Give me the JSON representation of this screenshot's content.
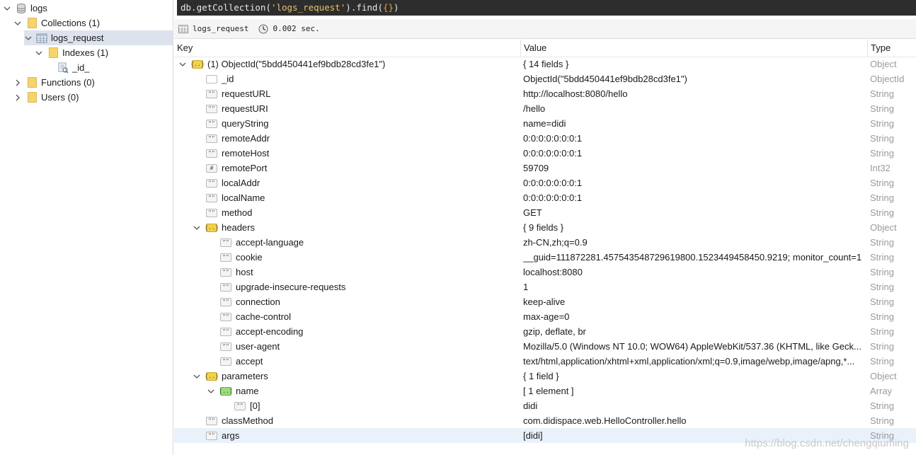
{
  "tree": {
    "db": {
      "label": "logs"
    },
    "collections": {
      "label": "Collections (1)"
    },
    "collection": {
      "label": "logs_request"
    },
    "indexes": {
      "label": "Indexes (1)"
    },
    "index": {
      "label": "_id_"
    },
    "functions": {
      "label": "Functions (0)"
    },
    "users": {
      "label": "Users (0)"
    }
  },
  "query": {
    "prefix": "db.getCollection(",
    "name": "'logs_request'",
    "mid": ").find(",
    "args": "{}",
    "end": ")"
  },
  "result_info": {
    "collection": "logs_request",
    "time": "0.002 sec."
  },
  "columns": {
    "key": "Key",
    "value": "Value",
    "type": "Type"
  },
  "rows": [
    {
      "key": "(1) ObjectId(\"5bdd450441ef9bdb28cd3fe1\")",
      "value": "{ 14 fields }",
      "type": "Object",
      "icon": "object-icon",
      "iconText": "{..}"
    },
    {
      "key": "_id",
      "value": "ObjectId(\"5bdd450441ef9bdb28cd3fe1\")",
      "type": "ObjectId",
      "icon": "objectid-icon",
      "iconText": ""
    },
    {
      "key": "requestURL",
      "value": "http://localhost:8080/hello",
      "type": "String",
      "icon": "string-icon",
      "iconText": "\"\""
    },
    {
      "key": "requestURI",
      "value": "/hello",
      "type": "String",
      "icon": "string-icon",
      "iconText": "\"\""
    },
    {
      "key": "queryString",
      "value": "name=didi",
      "type": "String",
      "icon": "string-icon",
      "iconText": "\"\""
    },
    {
      "key": "remoteAddr",
      "value": "0:0:0:0:0:0:0:1",
      "type": "String",
      "icon": "string-icon",
      "iconText": "\"\""
    },
    {
      "key": "remoteHost",
      "value": "0:0:0:0:0:0:0:1",
      "type": "String",
      "icon": "string-icon",
      "iconText": "\"\""
    },
    {
      "key": "remotePort",
      "value": "59709",
      "type": "Int32",
      "icon": "int-icon",
      "iconText": "#"
    },
    {
      "key": "localAddr",
      "value": "0:0:0:0:0:0:0:1",
      "type": "String",
      "icon": "string-icon",
      "iconText": "\"\""
    },
    {
      "key": "localName",
      "value": "0:0:0:0:0:0:0:1",
      "type": "String",
      "icon": "string-icon",
      "iconText": "\"\""
    },
    {
      "key": "method",
      "value": "GET",
      "type": "String",
      "icon": "string-icon",
      "iconText": "\"\""
    },
    {
      "key": "headers",
      "value": "{ 9 fields }",
      "type": "Object",
      "icon": "object-icon",
      "iconText": "{..}"
    },
    {
      "key": "accept-language",
      "value": "zh-CN,zh;q=0.9",
      "type": "String",
      "icon": "string-icon",
      "iconText": "\"\""
    },
    {
      "key": "cookie",
      "value": "__guid=111872281.457543548729619800.1523449458450.9219; monitor_count=1",
      "type": "String",
      "icon": "string-icon",
      "iconText": "\"\""
    },
    {
      "key": "host",
      "value": "localhost:8080",
      "type": "String",
      "icon": "string-icon",
      "iconText": "\"\""
    },
    {
      "key": "upgrade-insecure-requests",
      "value": "1",
      "type": "String",
      "icon": "string-icon",
      "iconText": "\"\""
    },
    {
      "key": "connection",
      "value": "keep-alive",
      "type": "String",
      "icon": "string-icon",
      "iconText": "\"\""
    },
    {
      "key": "cache-control",
      "value": "max-age=0",
      "type": "String",
      "icon": "string-icon",
      "iconText": "\"\""
    },
    {
      "key": "accept-encoding",
      "value": "gzip, deflate, br",
      "type": "String",
      "icon": "string-icon",
      "iconText": "\"\""
    },
    {
      "key": "user-agent",
      "value": "Mozilla/5.0 (Windows NT 10.0; WOW64) AppleWebKit/537.36 (KHTML, like Geck...",
      "type": "String",
      "icon": "string-icon",
      "iconText": "\"\""
    },
    {
      "key": "accept",
      "value": "text/html,application/xhtml+xml,application/xml;q=0.9,image/webp,image/apng,*...",
      "type": "String",
      "icon": "string-icon",
      "iconText": "\"\""
    },
    {
      "key": "parameters",
      "value": "{ 1 field }",
      "type": "Object",
      "icon": "object-icon",
      "iconText": "{..}"
    },
    {
      "key": "name",
      "value": "[ 1 element ]",
      "type": "Array",
      "icon": "array-icon",
      "iconText": "[..]"
    },
    {
      "key": "[0]",
      "value": "didi",
      "type": "String",
      "icon": "string-icon",
      "iconText": "\"\""
    },
    {
      "key": "classMethod",
      "value": "com.didispace.web.HelloController.hello",
      "type": "String",
      "icon": "string-icon",
      "iconText": "\"\""
    },
    {
      "key": "args",
      "value": "[didi]",
      "type": "String",
      "icon": "string-icon",
      "iconText": "\"\""
    }
  ],
  "watermark": "https://blog.csdn.net/chengqiuming",
  "colors": {
    "querybar_bg": "#2d2d2d",
    "selected_bg": "#dde3ec",
    "highlight_bg": "#e9f2fb",
    "type_text": "#9a9a9a"
  }
}
